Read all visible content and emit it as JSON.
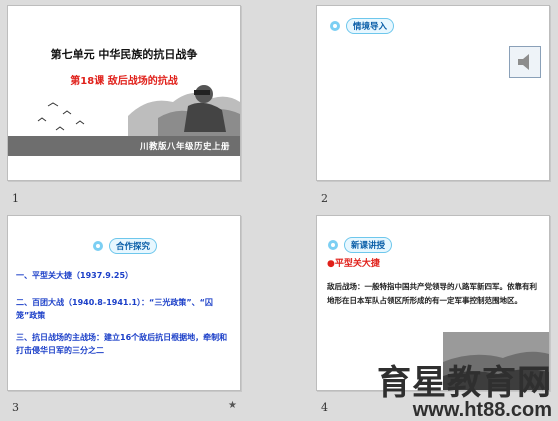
{
  "slides": [
    {
      "number": "1",
      "title": "第七单元  中华民族的抗日战争",
      "subtitle": "第18课   敌后战场的抗战",
      "band_text": "川教版八年级历史上册"
    },
    {
      "number": "2",
      "badge": "情境导入"
    },
    {
      "number": "3",
      "badge": "合作探究",
      "bullets": [
        "一、平型关大捷（1937.9.25）",
        "二、百团大战（1940.8-1941.1）：“三光政策”、“囚笼”政策",
        "三、抗日战场的主战场：建立16个敌后抗日根据地，牵制和打击侵华日军的三分之二"
      ]
    },
    {
      "number": "4",
      "badge": "新课讲授",
      "heading": "●平型关大捷",
      "paragraph": "敌后战场：一般特指中国共产党领导的八路军新四军。依靠有利地形在日本军队占领区所形成的有一定军事控制范围地区。"
    }
  ],
  "watermark": {
    "text": "育星教育网",
    "url": "www.ht88.com"
  },
  "star": "★",
  "colors": {
    "background": "#dcdcdc",
    "red_title": "#e0201a",
    "blue_text": "#1a3ec8"
  }
}
